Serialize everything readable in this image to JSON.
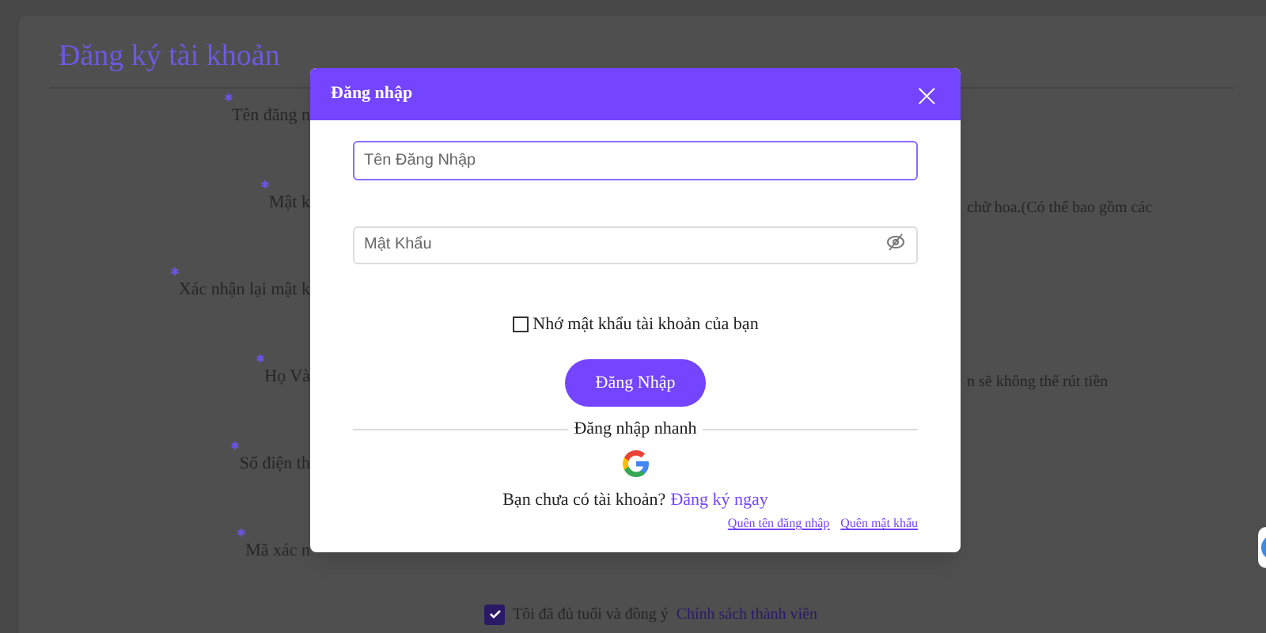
{
  "page": {
    "title": "Đăng ký tài khoản",
    "fields": [
      {
        "label": "Tên đăng n"
      },
      {
        "label": "Mật k",
        "note": "chữ hoa.(Có thể bao gồm các"
      },
      {
        "label": "Xác nhận lại mật k"
      },
      {
        "label": "Họ Và",
        "note": "n sẽ không thể rút tiền"
      },
      {
        "label": "Số điện th"
      },
      {
        "label": "Mã xác n"
      }
    ],
    "agree": {
      "checked": true,
      "text": "Tôi đã đủ tuổi và đồng ý",
      "link": "Chính sách thành viên"
    }
  },
  "dialog": {
    "title": "Đăng nhập",
    "close": "×",
    "username": {
      "placeholder": "Tên Đăng Nhập"
    },
    "password": {
      "placeholder": "Mật Khẩu"
    },
    "remember": {
      "checked": false,
      "label": "Nhớ mật khẩu tài khoản của bạn"
    },
    "submit": "Đăng Nhập",
    "divider": "Đăng nhập nhanh",
    "signup_prompt": "Bạn chưa có tài khoản?",
    "signup_link": "Đăng ký ngay",
    "links": [
      "Quên tên đăng nhập",
      "Quên mật khẩu"
    ]
  }
}
